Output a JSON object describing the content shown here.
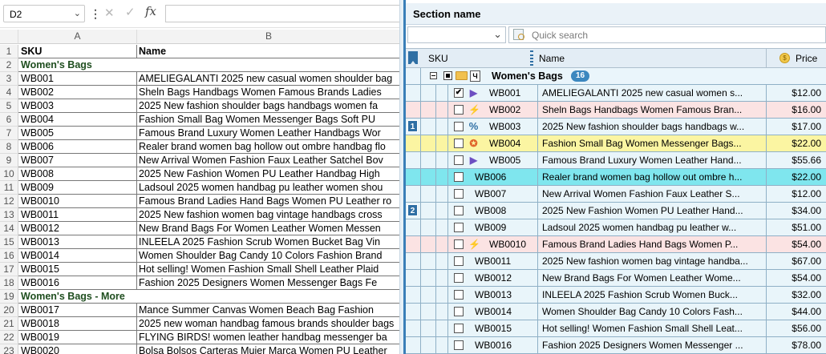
{
  "excel": {
    "namebox": "D2",
    "fx_label": "fx",
    "col_a": "A",
    "col_b": "B",
    "rows": [
      {
        "n": "1",
        "a": "SKU",
        "b": "Name",
        "header": true
      },
      {
        "n": "2",
        "a": "Women's Bags",
        "b": "",
        "group": true
      },
      {
        "n": "3",
        "a": "WB001",
        "b": "AMELIEGALANTI 2025 new casual women shoulder bag"
      },
      {
        "n": "4",
        "a": "WB002",
        "b": "Sheln Bags Handbags Women Famous Brands Ladies"
      },
      {
        "n": "5",
        "a": "WB003",
        "b": "2025 New fashion shoulder bags handbags women fa"
      },
      {
        "n": "6",
        "a": "WB004",
        "b": "Fashion Small Bag Women Messenger Bags Soft PU"
      },
      {
        "n": "7",
        "a": "WB005",
        "b": "Famous Brand Luxury Women Leather Handbags Wor"
      },
      {
        "n": "8",
        "a": "WB006",
        "b": "Realer brand women bag hollow out ombre handbag flo"
      },
      {
        "n": "9",
        "a": "WB007",
        "b": "New Arrival Women Fashion Faux Leather Satchel Bov"
      },
      {
        "n": "10",
        "a": "WB008",
        "b": "2025 New Fashion Women PU Leather Handbag High"
      },
      {
        "n": "11",
        "a": "WB009",
        "b": "Ladsoul 2025 women handbag pu leather women shou"
      },
      {
        "n": "12",
        "a": "WB0010",
        "b": "Famous Brand Ladies Hand Bags Women PU Leather ro"
      },
      {
        "n": "13",
        "a": "WB0011",
        "b": "2025 New fashion women bag vintage handbags cross"
      },
      {
        "n": "14",
        "a": "WB0012",
        "b": "New Brand Bags For Women Leather Women Messen"
      },
      {
        "n": "15",
        "a": "WB0013",
        "b": "INLEELA 2025 Fashion Scrub Women Bucket Bag Vin"
      },
      {
        "n": "16",
        "a": "WB0014",
        "b": "Women Shoulder Bag Candy 10 Colors Fashion Brand"
      },
      {
        "n": "17",
        "a": "WB0015",
        "b": "Hot selling! Women Fashion Small Shell Leather Plaid"
      },
      {
        "n": "18",
        "a": "WB0016",
        "b": "Fashion 2025 Designers Women Messenger Bags Fe"
      },
      {
        "n": "19",
        "a": "Women's Bags - More",
        "b": "",
        "group": true
      },
      {
        "n": "20",
        "a": "WB0017",
        "b": "Mance Summer Canvas Women Beach Bag Fashion"
      },
      {
        "n": "21",
        "a": "WB0018",
        "b": "2025 new woman handbag famous brands shoulder bags"
      },
      {
        "n": "22",
        "a": "WB0019",
        "b": "FLYING BIRDS! women leather handbag messenger ba"
      },
      {
        "n": "23",
        "a": "WB0020",
        "b": "Bolsa Bolsos Carteras Mujer Marca Women PU Leather"
      }
    ]
  },
  "panel": {
    "section_title": "Section name",
    "quick_search_placeholder": "Quick search",
    "columns": {
      "sku": "SKU",
      "name": "Name",
      "price": "Price"
    },
    "group": {
      "title": "Women's Bags",
      "count": "16",
      "doc_glyph": "Ч"
    },
    "rows": [
      {
        "sku": "WB001",
        "name": "AMELIEGALANTI 2025 new casual women s...",
        "price": "$12.00",
        "checked": true,
        "icon": "flag",
        "bg": "#e9f5fa",
        "mark": ""
      },
      {
        "sku": "WB002",
        "name": "Sheln Bags Handbags Women Famous Bran...",
        "price": "$16.00",
        "checked": false,
        "icon": "bolt",
        "bg": "#fbe3e3",
        "mark": ""
      },
      {
        "sku": "WB003",
        "name": "2025 New fashion shoulder bags handbags w...",
        "price": "$17.00",
        "checked": false,
        "icon": "pct",
        "bg": "#e9f5fa",
        "mark": "1"
      },
      {
        "sku": "WB004",
        "name": "Fashion Small Bag Women Messenger Bags...",
        "price": "$22.00",
        "checked": false,
        "icon": "medal",
        "bg": "#fbf5a2",
        "mark": ""
      },
      {
        "sku": "WB005",
        "name": "Famous Brand Luxury Women Leather Hand...",
        "price": "$55.66",
        "checked": false,
        "icon": "flag",
        "bg": "#e9f5fa",
        "mark": ""
      },
      {
        "sku": "WB006",
        "name": "Realer brand women bag hollow out ombre h...",
        "price": "$22.00",
        "checked": false,
        "icon": "",
        "bg": "#7fe6ee",
        "mark": ""
      },
      {
        "sku": "WB007",
        "name": "New Arrival Women Fashion Faux Leather S...",
        "price": "$12.00",
        "checked": false,
        "icon": "",
        "bg": "#e9f5fa",
        "mark": ""
      },
      {
        "sku": "WB008",
        "name": "2025 New Fashion Women PU Leather Hand...",
        "price": "$34.00",
        "checked": false,
        "icon": "",
        "bg": "#e9f5fa",
        "mark": "2"
      },
      {
        "sku": "WB009",
        "name": "Ladsoul 2025 women handbag pu leather w...",
        "price": "$51.00",
        "checked": false,
        "icon": "",
        "bg": "#e9f5fa",
        "mark": ""
      },
      {
        "sku": "WB0010",
        "name": "Famous Brand Ladies Hand Bags Women P...",
        "price": "$54.00",
        "checked": false,
        "icon": "bolt",
        "bg": "#fbe3e3",
        "mark": ""
      },
      {
        "sku": "WB0011",
        "name": "2025 New fashion women bag vintage handba...",
        "price": "$67.00",
        "checked": false,
        "icon": "",
        "bg": "#e9f5fa",
        "mark": ""
      },
      {
        "sku": "WB0012",
        "name": "New Brand Bags For Women Leather Wome...",
        "price": "$54.00",
        "checked": false,
        "icon": "",
        "bg": "#e9f5fa",
        "mark": ""
      },
      {
        "sku": "WB0013",
        "name": "INLEELA 2025 Fashion Scrub Women Buck...",
        "price": "$32.00",
        "checked": false,
        "icon": "",
        "bg": "#e9f5fa",
        "mark": ""
      },
      {
        "sku": "WB0014",
        "name": "Women Shoulder Bag Candy 10 Colors Fash...",
        "price": "$44.00",
        "checked": false,
        "icon": "",
        "bg": "#e9f5fa",
        "mark": ""
      },
      {
        "sku": "WB0015",
        "name": "Hot selling! Women Fashion Small Shell Leat...",
        "price": "$56.00",
        "checked": false,
        "icon": "",
        "bg": "#e9f5fa",
        "mark": ""
      },
      {
        "sku": "WB0016",
        "name": "Fashion 2025 Designers Women Messenger ...",
        "price": "$78.00",
        "checked": false,
        "icon": "",
        "bg": "#e9f5fa",
        "mark": ""
      }
    ]
  },
  "icons": {
    "flag": "▶",
    "bolt": "⚡",
    "pct": "%",
    "medal": "✪",
    "check": "✔",
    "x": "✕",
    "checkmark": "✓",
    "dropdown": "⌄"
  }
}
